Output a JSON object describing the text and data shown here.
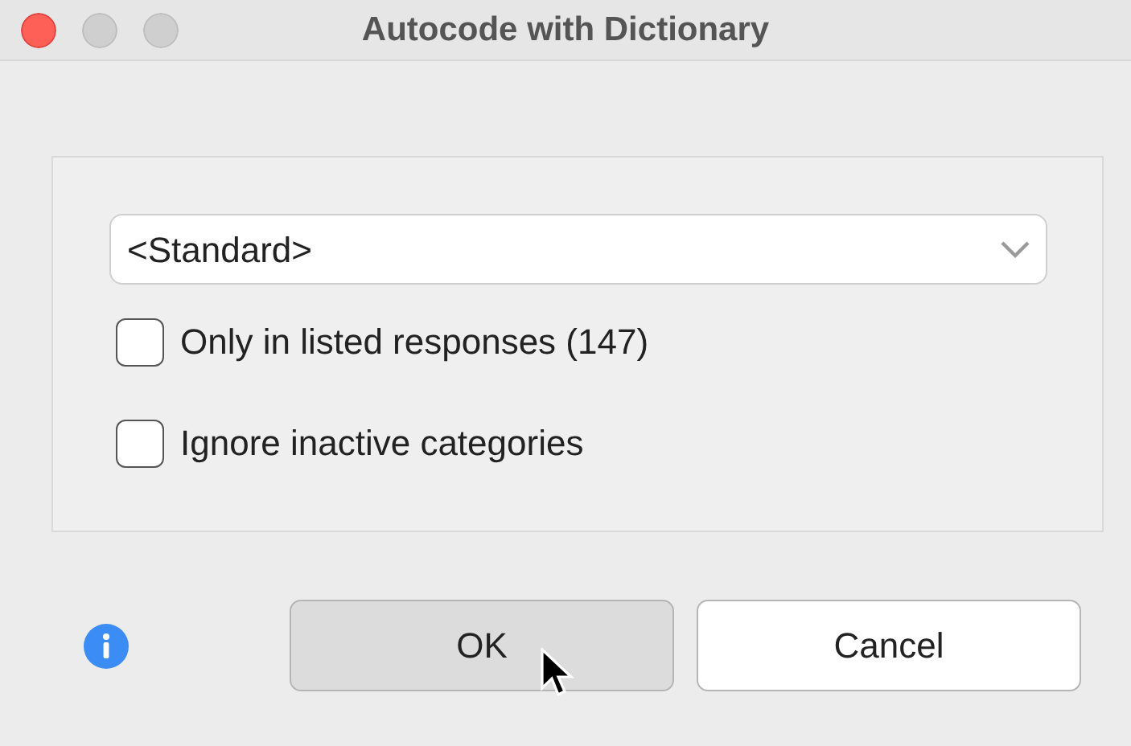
{
  "window": {
    "title": "Autocode with Dictionary"
  },
  "dictionary_select": {
    "value": "<Standard>"
  },
  "options": [
    {
      "label": "Only in listed responses (147)",
      "checked": false
    },
    {
      "label": "Ignore inactive categories",
      "checked": false
    }
  ],
  "buttons": [
    {
      "label": "OK",
      "pressed": true
    },
    {
      "label": "Cancel",
      "pressed": false
    }
  ]
}
